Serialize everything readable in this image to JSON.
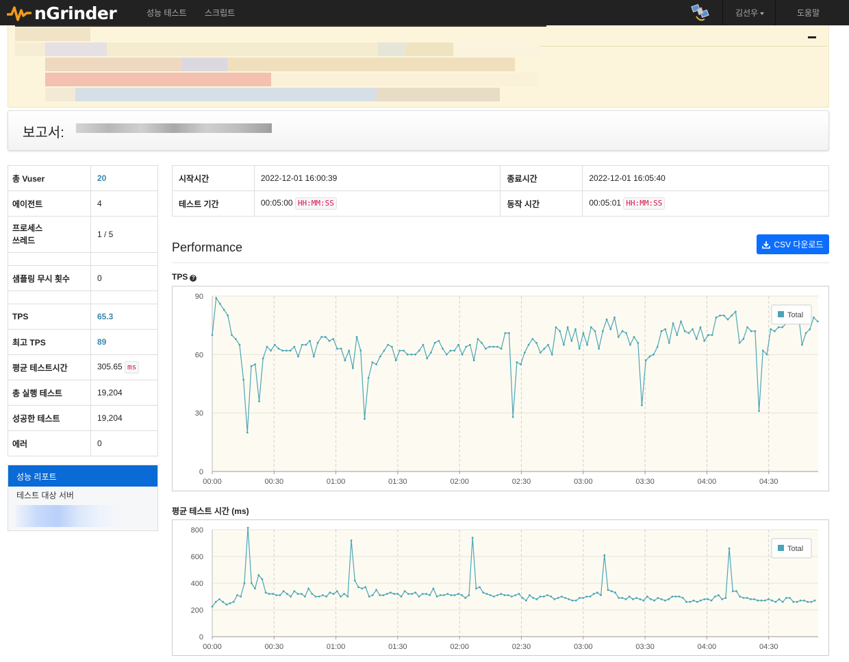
{
  "nav": {
    "brand": "nGrinder",
    "menu": [
      "성능 테스트",
      "스크립트"
    ],
    "user": "김선우",
    "help": "도움말"
  },
  "report": {
    "title_prefix": "보고서:"
  },
  "stats": [
    {
      "key": "총 Vuser",
      "value": "20",
      "highlight": true
    },
    {
      "key": "에이전트",
      "value": "4"
    },
    {
      "key": "프로세스\n쓰레드",
      "value": "1 / 5"
    },
    {
      "key": "",
      "value": ""
    },
    {
      "key": "샘플링 무시 횟수",
      "value": "0"
    },
    {
      "key": "",
      "value": ""
    },
    {
      "key": "TPS",
      "value": "65.3",
      "highlight": true
    },
    {
      "key": "최고 TPS",
      "value": "89",
      "highlight": true
    },
    {
      "key": "평균 테스트시간",
      "value": "305.65",
      "unit": "ms"
    },
    {
      "key": "총 실행 테스트",
      "value": "19,204"
    },
    {
      "key": "성공한 테스트",
      "value": "19,204"
    },
    {
      "key": "에러",
      "value": "0"
    }
  ],
  "side_menu": {
    "active": "성능 리포트",
    "item": "테스트 대상 서버"
  },
  "times": {
    "start_label": "시작시간",
    "start_value": "2022-12-01 16:00:39",
    "end_label": "종료시간",
    "end_value": "2022-12-01 16:05:40",
    "duration_label": "테스트 기간",
    "duration_value": "00:05:00",
    "duration_format": "HH:MM:SS",
    "run_label": "동작 시간",
    "run_value": "00:05:01",
    "run_format": "HH:MM:SS"
  },
  "performance": {
    "title": "Performance",
    "csv_button": "CSV 다운로드"
  },
  "chart_data": [
    {
      "type": "line",
      "title": "TPS",
      "ylim": [
        0,
        90
      ],
      "yticks": [
        0,
        30,
        60,
        90
      ],
      "xticks": [
        "00:00",
        "00:30",
        "01:00",
        "01:30",
        "02:00",
        "02:30",
        "03:00",
        "03:30",
        "04:00",
        "04:30"
      ],
      "x_range_seconds": [
        0,
        294
      ],
      "legend": "top-right",
      "grid": true,
      "series": [
        {
          "name": "Total",
          "color": "#4aa5b8",
          "values": [
            70,
            89,
            86,
            83,
            80,
            70,
            68,
            65,
            47,
            20,
            54,
            55,
            36,
            58,
            64,
            62,
            65,
            63,
            62,
            62,
            62,
            64,
            59,
            65,
            65,
            67,
            59,
            66,
            69,
            69,
            67,
            68,
            63,
            63,
            57,
            62,
            53,
            69,
            62,
            27,
            48,
            56,
            55,
            59,
            62,
            65,
            64,
            57,
            62,
            62,
            60,
            60,
            60,
            62,
            65,
            58,
            61,
            66,
            67,
            63,
            60,
            62,
            62,
            65,
            60,
            64,
            65,
            57,
            68,
            66,
            63,
            64,
            64,
            64,
            63,
            71,
            71,
            28,
            56,
            55,
            61,
            65,
            68,
            66,
            61,
            63,
            65,
            60,
            74,
            72,
            65,
            74,
            67,
            73,
            63,
            71,
            65,
            74,
            72,
            63,
            72,
            78,
            73,
            79,
            69,
            72,
            71,
            65,
            69,
            66,
            34,
            57,
            59,
            60,
            64,
            72,
            73,
            66,
            76,
            70,
            77,
            72,
            71,
            73,
            68,
            74,
            67,
            70,
            70,
            79,
            80,
            80,
            78,
            80,
            82,
            66,
            68,
            74,
            72,
            72,
            31,
            62,
            60,
            73,
            72,
            74,
            74,
            76,
            77,
            79,
            82,
            65,
            71,
            73,
            79,
            77,
            77
          ]
        }
      ]
    },
    {
      "type": "line",
      "title": "평균 테스트 시간 (ms)",
      "ylim": [
        0,
        800
      ],
      "yticks": [
        0,
        200,
        400,
        600,
        800
      ],
      "xticks": [
        "00:00",
        "00:30",
        "01:00",
        "01:30",
        "02:00",
        "02:30",
        "03:00",
        "03:30",
        "04:00",
        "04:30"
      ],
      "x_range_seconds": [
        0,
        294
      ],
      "legend": "top-right",
      "grid": true,
      "series": [
        {
          "name": "Total",
          "color": "#4aa5b8",
          "values": [
            225,
            260,
            280,
            260,
            240,
            250,
            260,
            310,
            300,
            400,
            815,
            400,
            360,
            460,
            430,
            330,
            320,
            320,
            310,
            310,
            340,
            320,
            300,
            340,
            320,
            320,
            300,
            360,
            320,
            300,
            300,
            310,
            300,
            330,
            320,
            340,
            300,
            320,
            300,
            720,
            420,
            370,
            360,
            370,
            300,
            310,
            350,
            310,
            310,
            320,
            330,
            320,
            320,
            300,
            340,
            320,
            320,
            330,
            300,
            320,
            320,
            310,
            360,
            300,
            310,
            310,
            320,
            310,
            310,
            320,
            310,
            290,
            310,
            740,
            360,
            370,
            330,
            320,
            310,
            300,
            310,
            320,
            310,
            310,
            300,
            310,
            320,
            290,
            270,
            310,
            290,
            280,
            300,
            300,
            310,
            300,
            280,
            290,
            300,
            290,
            280,
            270,
            270,
            290,
            290,
            300,
            300,
            320,
            330,
            310,
            610,
            350,
            340,
            330,
            290,
            290,
            280,
            300,
            280,
            290,
            280,
            270,
            300,
            280,
            270,
            290,
            280,
            270,
            280,
            300,
            300,
            300,
            290,
            260,
            260,
            270,
            260,
            270,
            280,
            280,
            270,
            300,
            310,
            280,
            290,
            660,
            340,
            340,
            300,
            290,
            290,
            280,
            280,
            270,
            270,
            270,
            280,
            270,
            260,
            280,
            260,
            290,
            290,
            260,
            260,
            270,
            270,
            260,
            260,
            270
          ]
        }
      ]
    }
  ]
}
